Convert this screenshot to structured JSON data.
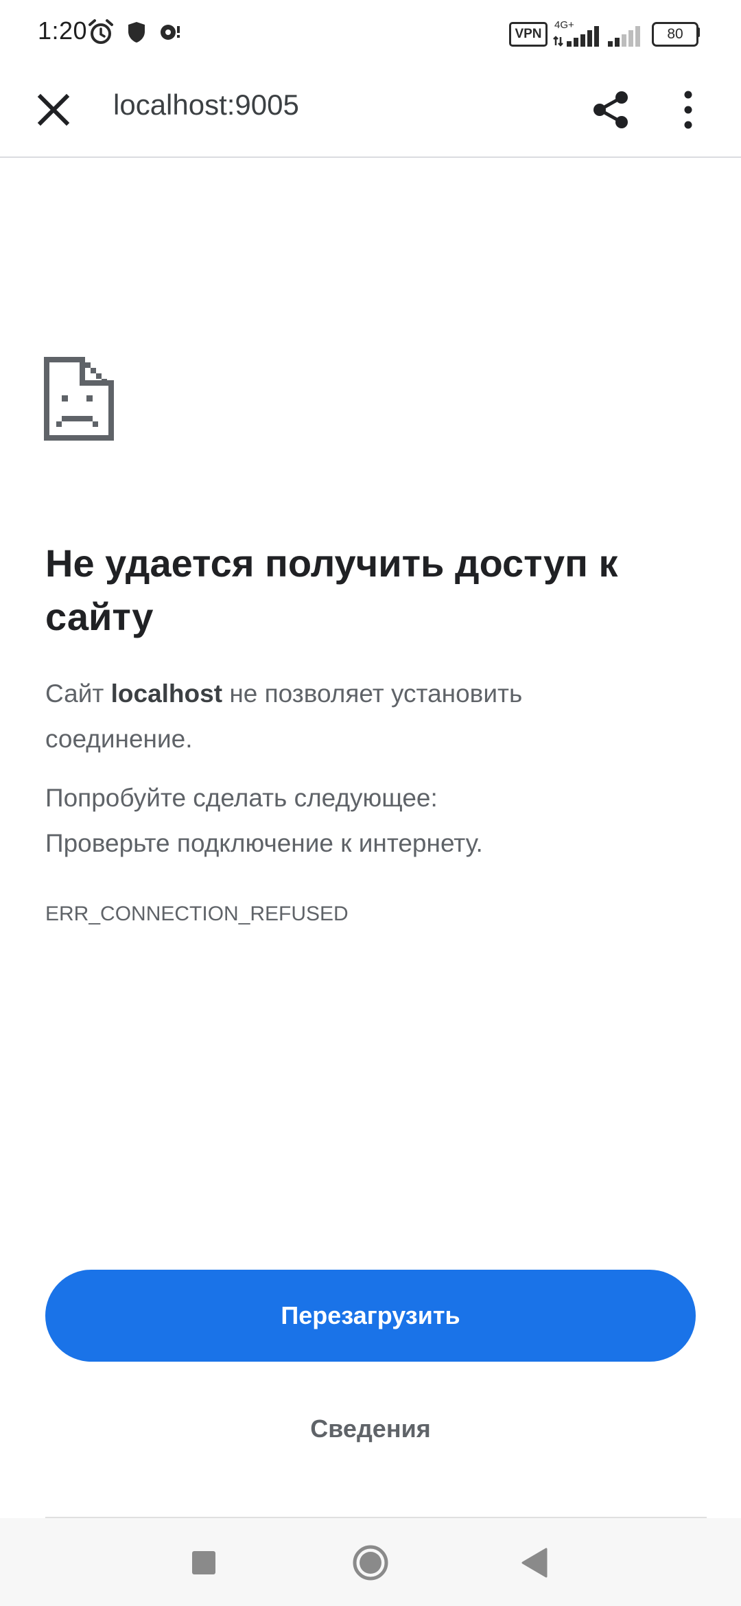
{
  "status_bar": {
    "time": "1:20",
    "vpn_label": "VPN",
    "network_type": "4G+",
    "battery_level": "80",
    "icons": [
      "alarm-icon",
      "shield-icon",
      "media-icon",
      "signal-icon",
      "signal-weak-icon"
    ]
  },
  "toolbar": {
    "url": "localhost:9005",
    "icons": [
      "close-icon",
      "share-icon",
      "more-vert-icon"
    ]
  },
  "error": {
    "icon": "broken-page-icon",
    "title": "Не удается получить доступ к сайту",
    "desc_prefix": "Сайт",
    "desc_host": "localhost",
    "desc_suffix": "не позволяет установить соединение.",
    "suggestions_heading": "Попробуйте сделать следующее:",
    "suggestion_item": "Проверьте подключение к интернету.",
    "code": "ERR_CONNECTION_REFUSED"
  },
  "actions": {
    "reload_label": "Перезагрузить",
    "details_label": "Сведения"
  },
  "navigation": {
    "icons": [
      "recents-icon",
      "home-icon",
      "back-icon"
    ]
  },
  "colors": {
    "accent": "#1a73e8",
    "title_text": "#202124",
    "body_text": "#5f6368"
  }
}
